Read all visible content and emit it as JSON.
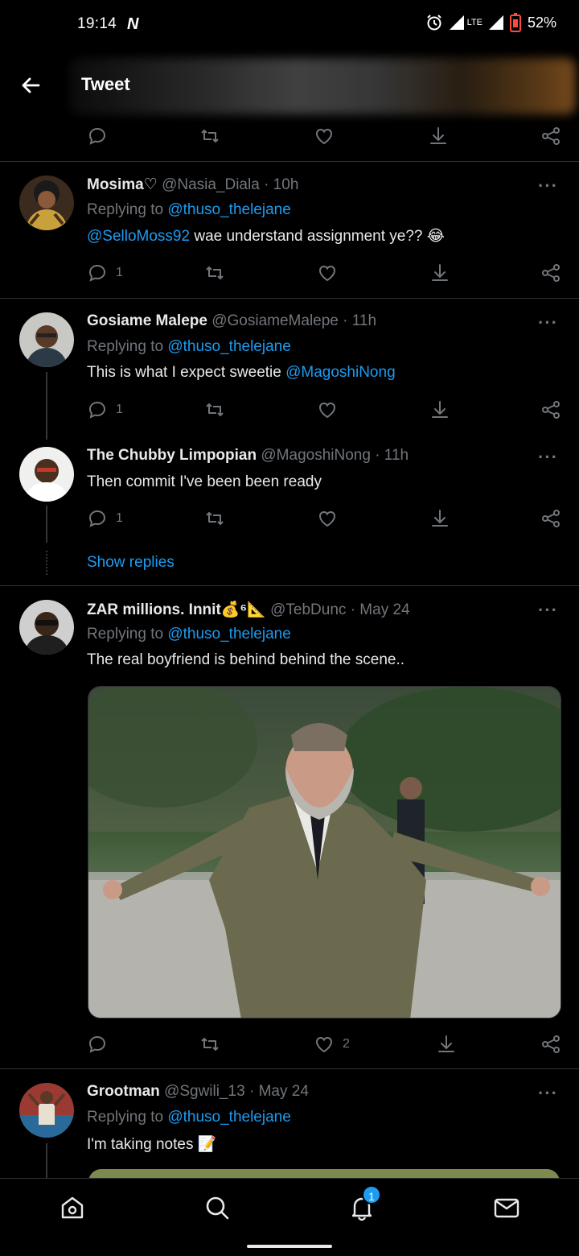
{
  "status": {
    "time": "19:14",
    "carrier_logo": "N",
    "network": "LTE",
    "battery": "52%"
  },
  "header": {
    "title": "Tweet"
  },
  "colors": {
    "accent": "#1d9bf0",
    "muted": "#71767b",
    "background": "#000000"
  },
  "tweets": [
    {
      "name": "Mosima♡",
      "handle": "@Nasia_Diala",
      "time": "· 10h",
      "replying_prefix": "Replying to",
      "replying_to": "@thuso_thelejane",
      "mention": "@SelloMoss92",
      "text": " wae understand assignment ye?? 😂",
      "reply_count": "1"
    },
    {
      "name": "Gosiame Malepe",
      "handle": "@GosiameMalepe",
      "time": "· 11h",
      "replying_prefix": "Replying to",
      "replying_to": "@thuso_thelejane",
      "text": "This is what I expect sweetie ",
      "mention": "@MagoshiNong",
      "reply_count": "1"
    },
    {
      "name": "The Chubby Limpopian",
      "handle": "@MagoshiNong",
      "time": "· 11h",
      "text": "Then commit I've been been ready",
      "reply_count": "1",
      "show_replies": "Show replies"
    },
    {
      "name": "ZAR millions. Innit💰⁶📐",
      "handle": "@TebDunc",
      "time": "· May 24",
      "replying_prefix": "Replying to",
      "replying_to": "@thuso_thelejane",
      "text": "The real boyfriend is behind behind the scene..",
      "like_count": "2"
    },
    {
      "name": "Grootman",
      "handle": "@Sgwili_13",
      "time": "· May 24",
      "replying_prefix": "Replying to",
      "replying_to": "@thuso_thelejane",
      "text": "I'm taking notes 📝"
    }
  ],
  "nav": {
    "notifications_badge": "1",
    "items": [
      "home-icon",
      "search-icon",
      "bell-icon",
      "mail-icon"
    ]
  }
}
